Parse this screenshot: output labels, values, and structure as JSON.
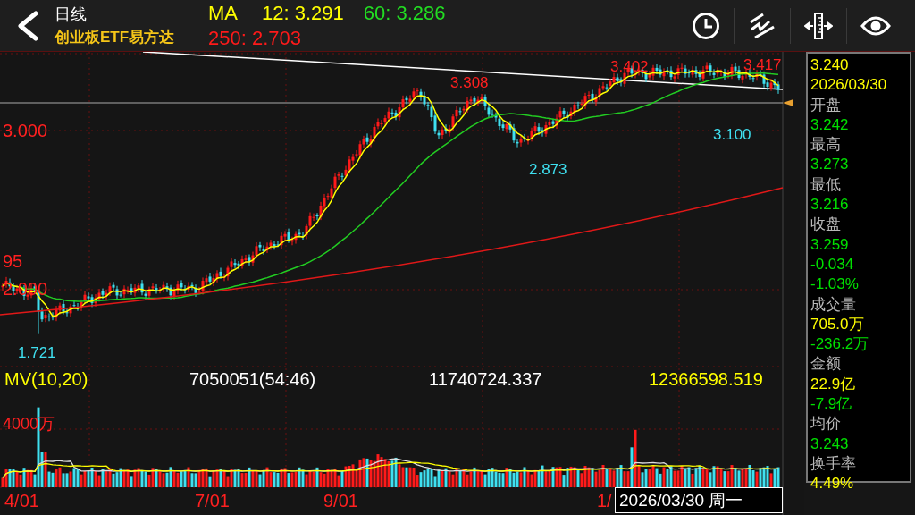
{
  "header": {
    "period": "日线",
    "name": "创业板ETF易方达",
    "ma_label": "MA",
    "ma_values": [
      {
        "text": "12: 3.291",
        "color": "#ffff00"
      },
      {
        "text": "60: 3.286",
        "color": "#22dd22"
      },
      {
        "text": "250: 2.703",
        "color": "#ff1a1a"
      }
    ]
  },
  "price_chart": {
    "labels": [
      {
        "text": "3.308",
        "kind": "high"
      },
      {
        "text": "3.402",
        "kind": "high"
      },
      {
        "text": "3.417",
        "kind": "high"
      },
      {
        "text": "3.100",
        "kind": "low"
      },
      {
        "text": "2.873",
        "kind": "low"
      },
      {
        "text": "1.721",
        "kind": "low"
      },
      {
        "text": "3.000",
        "kind": "axis"
      },
      {
        "text": "95",
        "kind": "axis"
      },
      {
        "text": "2.000",
        "kind": "axis"
      }
    ]
  },
  "volume": {
    "indicator": "MV(10,20)",
    "values": [
      {
        "text": "7050051(54:46)",
        "color": "#ffffff"
      },
      {
        "text": "11740724.337",
        "color": "#ffffff"
      },
      {
        "text": "12366598.519",
        "color": "#ffff00"
      }
    ],
    "axis_label": "4000万"
  },
  "x_axis": [
    "4/01",
    "7/01",
    "9/01",
    "1/"
  ],
  "cursor_date": "2026/03/30 周一",
  "info_panel": {
    "price": "3.240",
    "date": "2026/03/30",
    "fields": [
      {
        "label": "开盘",
        "values": [
          {
            "text": "3.242",
            "color": "#00e000"
          }
        ]
      },
      {
        "label": "最高",
        "values": [
          {
            "text": "3.273",
            "color": "#00e000"
          }
        ]
      },
      {
        "label": "最低",
        "values": [
          {
            "text": "3.216",
            "color": "#00e000"
          }
        ]
      },
      {
        "label": "收盘",
        "values": [
          {
            "text": "3.259",
            "color": "#00e000"
          },
          {
            "text": "-0.034",
            "color": "#00e000"
          },
          {
            "text": "-1.03%",
            "color": "#00e000"
          }
        ]
      },
      {
        "label": "成交量",
        "values": [
          {
            "text": "705.0万",
            "color": "#ffff00"
          },
          {
            "text": "-236.2万",
            "color": "#00e000"
          }
        ]
      },
      {
        "label": "金额",
        "values": [
          {
            "text": "22.9亿",
            "color": "#ffff00"
          },
          {
            "text": "-7.9亿",
            "color": "#00e000"
          }
        ]
      },
      {
        "label": "均价",
        "values": [
          {
            "text": "3.243",
            "color": "#00e000"
          }
        ]
      },
      {
        "label": "换手率",
        "values": [
          {
            "text": "4.49%",
            "color": "#ffff00"
          }
        ]
      }
    ]
  }
}
